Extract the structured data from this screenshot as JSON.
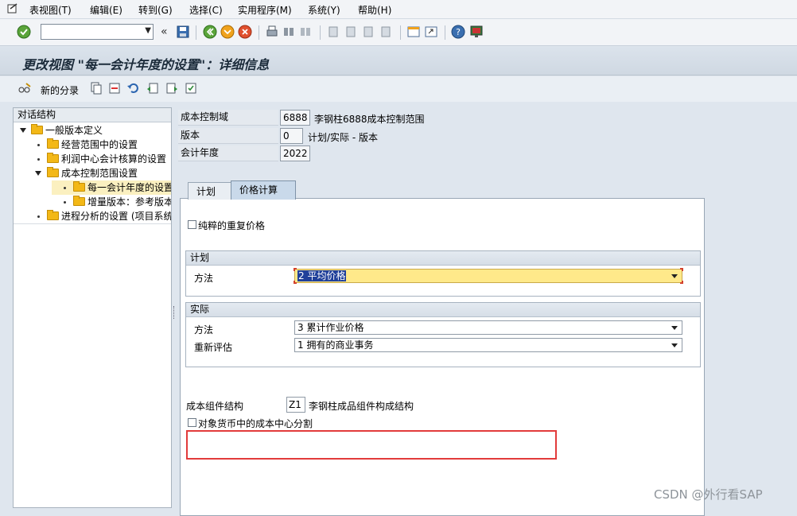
{
  "menu": [
    "表视图(T)",
    "编辑(E)",
    "转到(G)",
    "选择(C)",
    "实用程序(M)",
    "系统(Y)",
    "帮助(H)"
  ],
  "command_field": {
    "value": ""
  },
  "title": "更改视图 \"每一会计年度的设置\"：详细信息",
  "app_toolbar": {
    "new_entries_label": "新的分录"
  },
  "tree": {
    "header": "对话结构",
    "items": [
      {
        "label": "一般版本定义",
        "level": 0,
        "expanded": true
      },
      {
        "label": "经营范围中的设置",
        "level": 1
      },
      {
        "label": "利润中心会计核算的设置",
        "level": 1
      },
      {
        "label": "成本控制范围设置",
        "level": 1,
        "expanded": true
      },
      {
        "label": "每一会计年度的设置",
        "level": 2,
        "selected": true
      },
      {
        "label": "增量版本：参考版本的分",
        "level": 2
      },
      {
        "label": "进程分析的设置 (项目系统",
        "level": 1
      }
    ]
  },
  "header_fields": {
    "controlling_area": {
      "label": "成本控制域",
      "value": "6888",
      "desc": "李钢柱6888成本控制范围"
    },
    "version": {
      "label": "版本",
      "value": "0",
      "desc": "计划/实际 - 版本"
    },
    "fiscal_year": {
      "label": "会计年度",
      "value": "2022"
    }
  },
  "tabs": [
    {
      "label": "计划",
      "active": false
    },
    {
      "label": "价格计算",
      "active": true
    }
  ],
  "price_calc": {
    "pure_revaluation_label": "纯粹的重复价格",
    "plan_group": {
      "title": "计划",
      "method_label": "方法",
      "method_value": "2 平均价格"
    },
    "actual_group": {
      "title": "实际",
      "method_label": "方法",
      "method_value": "3 累计作业价格",
      "revaluation_label": "重新评估",
      "revaluation_value": "1 拥有的商业事务"
    },
    "cost_component": {
      "label": "成本组件结构",
      "value": "Z1",
      "desc": "李钢柱成品组件构成结构"
    },
    "split_label": "对象货币中的成本中心分割"
  },
  "watermark": "CSDN @外行看SAP",
  "colors": {
    "highlight": "#e23b3b",
    "selected_row": "#fbf0c0",
    "folder": "#f3b817"
  }
}
